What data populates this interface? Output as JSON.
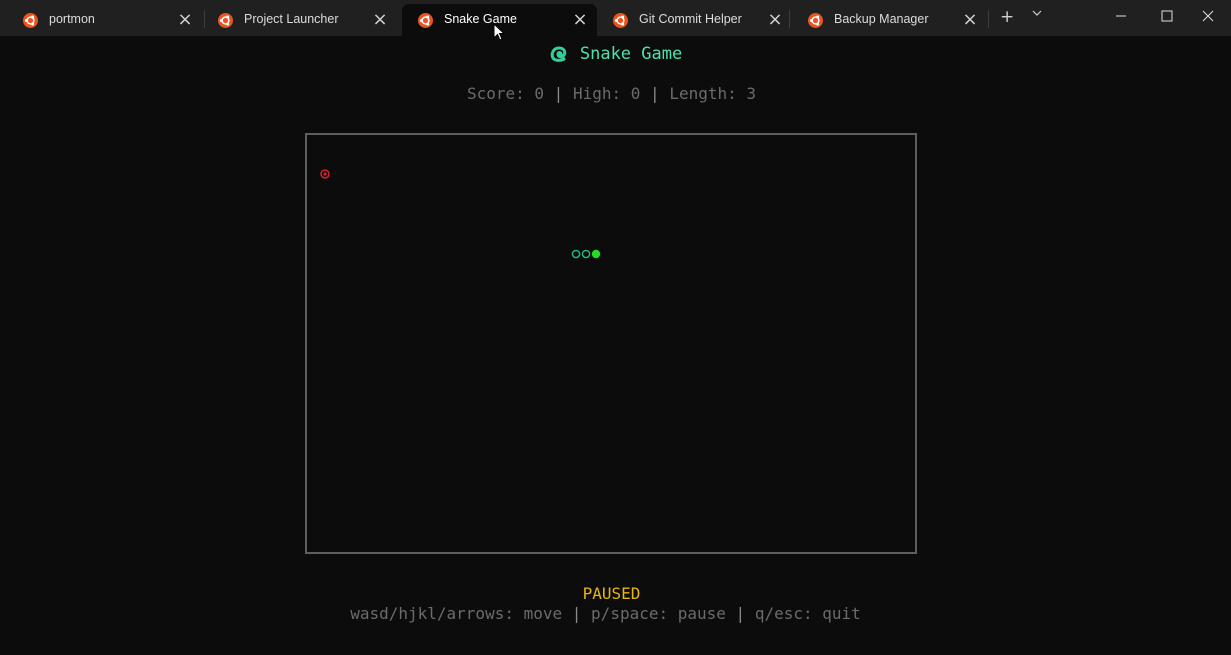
{
  "tabs": [
    {
      "label": "portmon",
      "icon": "ubuntu-icon",
      "active": false
    },
    {
      "label": "Project Launcher",
      "icon": "ubuntu-icon",
      "active": false
    },
    {
      "label": "Snake Game",
      "icon": "ubuntu-icon",
      "active": true
    },
    {
      "label": "Git Commit Helper",
      "icon": "ubuntu-icon",
      "active": false
    },
    {
      "label": "Backup Manager",
      "icon": "ubuntu-icon",
      "active": false
    }
  ],
  "toolbar": {
    "new_tab": "+",
    "dropdown": "⌄"
  },
  "window_controls": [
    "minimize-icon",
    "maximize-icon",
    "close-icon"
  ],
  "game": {
    "title": "Snake Game",
    "title_icon": "snake-icon",
    "stats": {
      "score_label": "Score:",
      "score": "0",
      "high_label": "High:",
      "high": "0",
      "length_label": "Length:",
      "length": "3",
      "separator": "|"
    },
    "status": "PAUSED",
    "help": {
      "move": "wasd/hjkl/arrows: move",
      "pause": "p/space: pause",
      "quit": "q/esc: quit",
      "separator": "|"
    }
  },
  "colors": {
    "accent": "#4ee0b0",
    "snake_head": "#22dd22",
    "snake_body": "#1fbf8a",
    "food": "#d11f2c",
    "paused": "#e8b60f",
    "muted_text": "#6b6b6b",
    "board_border": "#5e5e5e",
    "tab_icon": "#e95420"
  }
}
